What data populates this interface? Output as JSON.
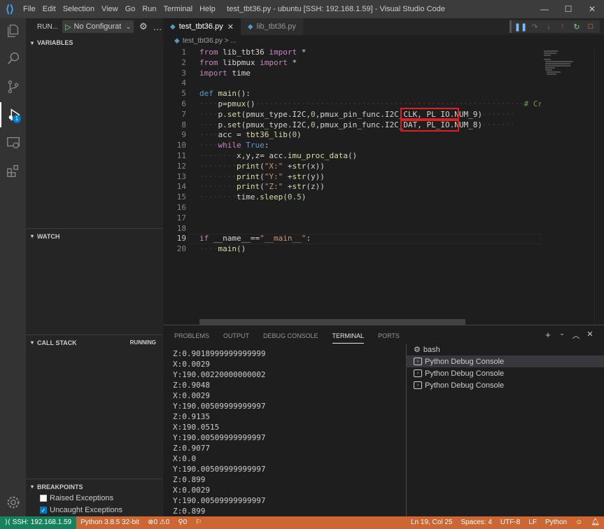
{
  "window": {
    "title": "test_tbt36.py - ubuntu [SSH: 192.168.1.59] - Visual Studio Code",
    "menu": [
      "File",
      "Edit",
      "Selection",
      "View",
      "Go",
      "Run",
      "Terminal",
      "Help"
    ],
    "controls": [
      "minimize-icon",
      "maximize-icon",
      "close-icon"
    ]
  },
  "sidebar": {
    "run_label": "RUN...",
    "config": "No Configurat",
    "sections": {
      "variables": "VARIABLES",
      "watch": "WATCH",
      "call_stack": "CALL STACK",
      "call_stack_state": "RUNNING",
      "breakpoints": "BREAKPOINTS"
    },
    "breakpoints": [
      {
        "label": "Raised Exceptions",
        "checked": false
      },
      {
        "label": "Uncaught Exceptions",
        "checked": true
      }
    ]
  },
  "activity": {
    "debug_badge": "1"
  },
  "tabs": [
    {
      "label": "test_tbt36.py",
      "active": true
    },
    {
      "label": "lib_tbt36.py",
      "active": false
    }
  ],
  "breadcrumb": {
    "file": "test_tbt36.py",
    "rest": "> ..."
  },
  "editor": {
    "current_line": "19",
    "line_numbers": [
      "1",
      "2",
      "3",
      "4",
      "5",
      "6",
      "7",
      "8",
      "9",
      "10",
      "11",
      "12",
      "13",
      "14",
      "15",
      "16",
      "17",
      "18",
      "19",
      "20"
    ],
    "comment_fragment": "# Create",
    "highlighted": [
      "PL_IO.NUM_9",
      "PL_IO.NUM_8"
    ]
  },
  "panel": {
    "tabs": [
      "PROBLEMS",
      "OUTPUT",
      "DEBUG CONSOLE",
      "TERMINAL",
      "PORTS"
    ],
    "active_tab": "TERMINAL",
    "terminal_output": [
      "Z:0.9018999999999999",
      "X:0.0029",
      "Y:190.00220000000002",
      "Z:0.9048",
      "X:0.0029",
      "Y:190.00509999999997",
      "Z:0.9135",
      "X:190.0515",
      "Y:190.00509999999997",
      "Z:0.9077",
      "X:0.0",
      "Y:190.00509999999997",
      "Z:0.899",
      "X:0.0029",
      "Y:190.00509999999997",
      "Z:0.899"
    ],
    "terminals": [
      {
        "label": "bash",
        "icon": "gear-icon",
        "selected": false
      },
      {
        "label": "Python Debug Console",
        "icon": "terminal-icon",
        "selected": true
      },
      {
        "label": "Python Debug Console",
        "icon": "terminal-icon",
        "selected": false
      },
      {
        "label": "Python Debug Console",
        "icon": "terminal-icon",
        "selected": false
      }
    ]
  },
  "statusbar": {
    "remote": "SSH: 192.168.1.59",
    "python": "Python 3.8.5 32-bit",
    "errors": "0",
    "warnings": "0",
    "ports": "0",
    "position": "Ln 19, Col 25",
    "spaces": "Spaces: 4",
    "encoding": "UTF-8",
    "eol": "LF",
    "language": "Python"
  },
  "colors": {
    "statusbar": "#cc6633",
    "remote": "#16825d",
    "highlight_box": "#e02020"
  }
}
